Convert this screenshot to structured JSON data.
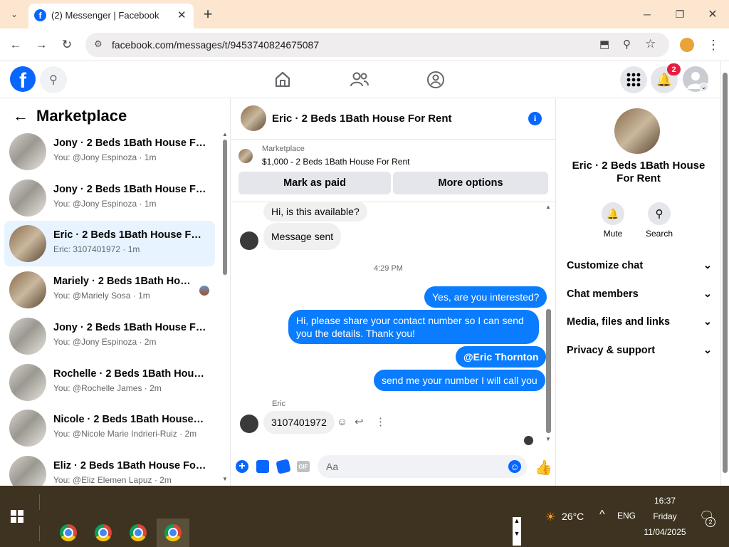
{
  "browser": {
    "tab_title": "(2) Messenger | Facebook",
    "url": "facebook.com/messages/t/9453740824675087"
  },
  "nav": {
    "notification_count": "2"
  },
  "left": {
    "title": "Marketplace",
    "conversations": [
      {
        "name": "Jony · 2 Beds 1Bath House For R...",
        "preview": "You: @Jony Espinoza · 1m"
      },
      {
        "name": "Jony · 2 Beds 1Bath House For R...",
        "preview": "You: @Jony Espinoza · 1m"
      },
      {
        "name": "Eric · 2 Beds 1Bath House For Rent",
        "preview": "Eric: 3107401972 · 1m"
      },
      {
        "name": "Mariely · 2 Beds 1Bath House ...",
        "preview": "You: @Mariely Sosa · 1m"
      },
      {
        "name": "Jony · 2 Beds 1Bath House For R...",
        "preview": "You: @Jony Espinoza · 2m"
      },
      {
        "name": "Rochelle · 2 Beds 1Bath House F...",
        "preview": "You: @Rochelle James · 2m"
      },
      {
        "name": "Nicole · 2 Beds 1Bath House For ...",
        "preview": "You: @Nicole Marie Indrieri-Ruiz · 2m"
      },
      {
        "name": "Eliz · 2 Beds 1Bath House For Rent",
        "preview": "You: @Eliz Elemen Lapuz · 2m"
      }
    ]
  },
  "chat": {
    "title": "Eric · 2 Beds 1Bath House For Rent",
    "listing_source": "Marketplace",
    "listing_title": "$1,000 - 2 Beds 1Bath House For Rent",
    "mark_paid": "Mark as paid",
    "more_options": "More options",
    "messages": {
      "m1": "Hi, is this available?",
      "m2": "Message sent",
      "time": "4:29 PM",
      "m3": "Yes, are you interested?",
      "m4": "Hi, please share your contact number so I can send you the details. Thank you!",
      "m5": "@Eric Thornton",
      "m6": "send me your number I will call you",
      "sender": "Eric",
      "m7": "3107401972"
    },
    "composer_placeholder": "Aa"
  },
  "right": {
    "name": "Eric · 2 Beds 1Bath House For Rent",
    "mute": "Mute",
    "search": "Search",
    "options": [
      "Customize chat",
      "Chat members",
      "Media, files and links",
      "Privacy & support"
    ]
  },
  "taskbar": {
    "temp": "26°C",
    "lang": "ENG",
    "time": "16:37",
    "day": "Friday",
    "date": "11/04/2025",
    "notif_count": "2"
  },
  "colors": {
    "accent": "#0a7cff",
    "fb_blue": "#0866ff",
    "badge": "#e41e3f"
  }
}
